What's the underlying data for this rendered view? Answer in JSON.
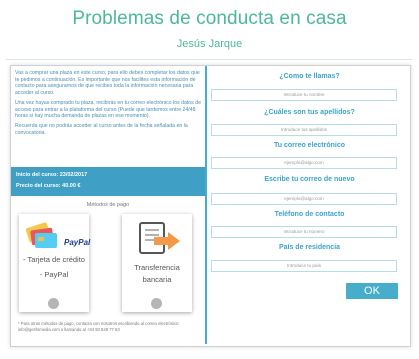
{
  "header": {
    "title": "Problemas de conducta en casa",
    "author": "Jesús Jarque"
  },
  "info": {
    "paragraph1": "Vas a comprar una plaza en este curso, para ello debes completar los datos que te pedimos a continuación. Es importante que nos facilites esta información de contacto para asegurarnos de que recibes toda la información necesaria para acceder al curso.",
    "paragraph2": "Una vez hayas comprado tu plaza, recibirás en tu correo electrónico los datos de acceso para entrar a la plataforma del curso (Puede que tardemos entre 24/48 horas si hay mucha demanda de plazas en ese momento).",
    "paragraph3": "Recuerda que no podrás acceder al curso antes de la fecha señalada en la convocatoria."
  },
  "course": {
    "start_date": "Inicio del curso: 23/02/2017",
    "price": "Precio del curso: 40.00 €"
  },
  "payment": {
    "title": "Métodos de pago",
    "option1_line1": "- Tarjeta de crédito",
    "option1_line2": "- PayPal",
    "paypal_logo": "PayPal",
    "option2_line1": "Transferencia",
    "option2_line2": "bancaria",
    "note": "* Para otros métodos de pago, contacta con nosotros escribiendo al correo electrónico: info@gesfomedia.com o llamando al +34 93 528 77 63"
  },
  "form": {
    "name_label": "¿Como te llamas?",
    "name_placeholder": "Introduce tu nombre",
    "surname_label": "¿Cuáles son tus apellidos?",
    "surname_placeholder": "Introduce tus apellidos",
    "email_label": "Tu correo electrónico",
    "email_placeholder": "ejemplo@algo.com",
    "email2_label": "Escribe tu correo de nuevo",
    "email2_placeholder": "ejemplo@algo.com",
    "phone_label": "Teléfono de contacto",
    "phone_placeholder": "Introduce tu número",
    "country_label": "País de residencia",
    "country_placeholder": "Introduce tu país",
    "submit_label": "OK"
  },
  "colors": {
    "title_green": "#4cb89a",
    "accent_blue": "#46aeca",
    "info_text": "#4b8fb6"
  },
  "icons": [
    "credit-cards-icon",
    "paypal-logo",
    "bank-transfer-icon"
  ]
}
